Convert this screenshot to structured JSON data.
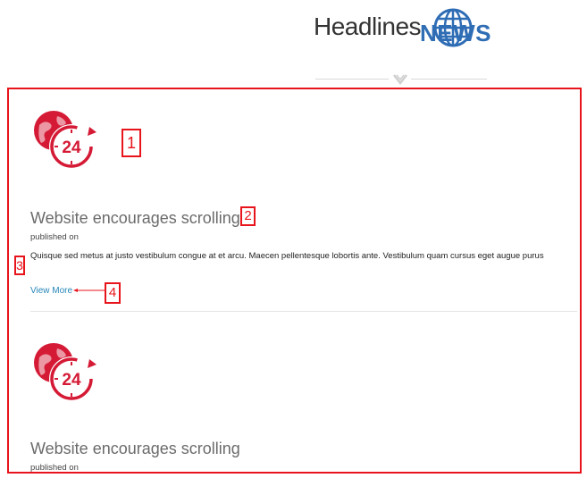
{
  "header": {
    "brand_text": "Headlines",
    "brand_news": "NEWS"
  },
  "articles": [
    {
      "icon_badge": "24",
      "title": "Website encourages scrolling",
      "meta": "published on",
      "body": "Quisque sed metus at justo vestibulum congue at et arcu. Maecen pellentesque lobortis ante. Vestibulum quam cursus eget augue purus",
      "view_more": "View More"
    },
    {
      "icon_badge": "24",
      "title": "Website encourages scrolling",
      "meta": "published on"
    }
  ],
  "annotations": [
    "1",
    "2",
    "3",
    "4"
  ],
  "colors": {
    "accent_red": "#e8141b",
    "icon_red": "#d51a35",
    "link_blue": "#2786b8",
    "news_blue": "#2f6db5"
  },
  "icons": [
    "globe-logo-icon",
    "chevron-down-icon",
    "clock-24-globe-icon"
  ]
}
